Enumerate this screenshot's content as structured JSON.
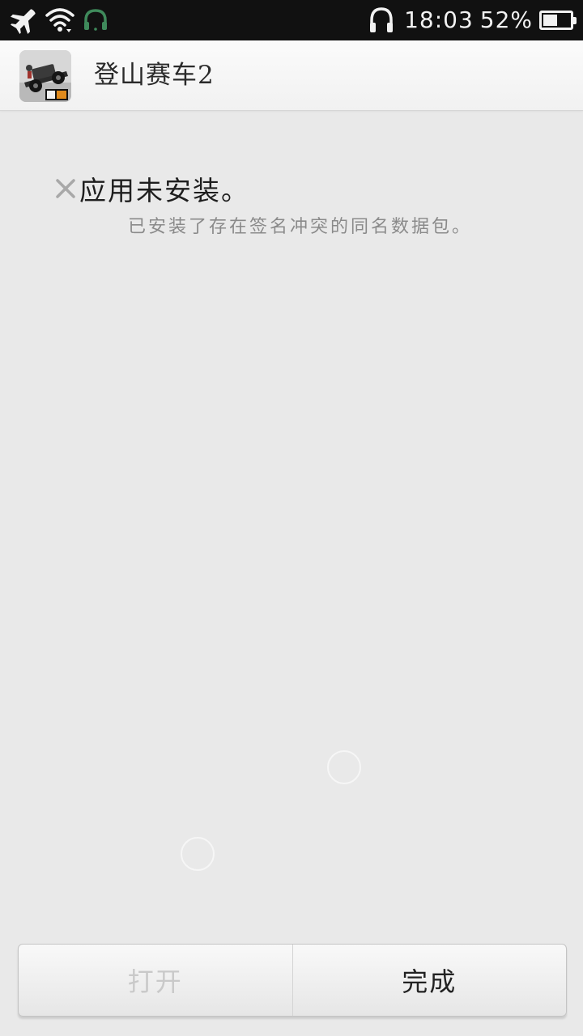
{
  "status_bar": {
    "time": "18:03",
    "battery_percent": "52%",
    "battery_level": 0.52,
    "icons": [
      "airplane-icon",
      "wifi-icon",
      "headset-icon",
      "headphones-icon",
      "battery-icon"
    ]
  },
  "app": {
    "title": "登山赛车2",
    "icon": "app-icon"
  },
  "message": {
    "title": "应用未安装。",
    "detail": "已安装了存在签名冲突的同名数据包。",
    "icon": "close-x-icon"
  },
  "buttons": {
    "open_label": "打开",
    "done_label": "完成"
  },
  "colors": {
    "background": "#e9e9e9",
    "status_bar": "#111111",
    "disabled_text": "#c9c9c9"
  }
}
